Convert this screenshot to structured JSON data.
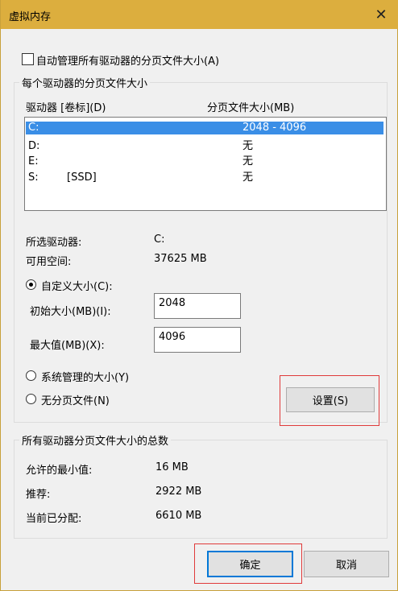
{
  "window": {
    "title": "虚拟内存",
    "close_glyph": "✕"
  },
  "auto_manage": {
    "label": "自动管理所有驱动器的分页文件大小(A)",
    "checked": false
  },
  "per_drive_group": {
    "legend": "每个驱动器的分页文件大小",
    "col_drive": "驱动器 [卷标](D)",
    "col_size": "分页文件大小(MB)",
    "rows": [
      {
        "drive": "C:",
        "label": "",
        "size": "2048 - 4096",
        "selected": true
      },
      {
        "drive": "D:",
        "label": "",
        "size": "无",
        "selected": false
      },
      {
        "drive": "E:",
        "label": "",
        "size": "无",
        "selected": false
      },
      {
        "drive": "S:",
        "label": "[SSD]",
        "size": "无",
        "selected": false
      }
    ],
    "selected_drive_label": "所选驱动器:",
    "selected_drive_value": "C:",
    "free_space_label": "可用空间:",
    "free_space_value": "37625 MB",
    "custom_size_label": "自定义大小(C):",
    "initial_size_label": "初始大小(MB)(I):",
    "initial_size_value": "2048",
    "max_size_label": "最大值(MB)(X):",
    "max_size_value": "4096",
    "system_managed_label": "系统管理的大小(Y)",
    "no_paging_label": "无分页文件(N)",
    "set_button": "设置(S)"
  },
  "totals_group": {
    "legend": "所有驱动器分页文件大小的总数",
    "min_label": "允许的最小值:",
    "min_value": "16 MB",
    "recommended_label": "推荐:",
    "recommended_value": "2922 MB",
    "current_label": "当前已分配:",
    "current_value": "6610 MB"
  },
  "footer": {
    "ok_button": "确定",
    "cancel_button": "取消"
  },
  "colors": {
    "titlebar": "#dcae3e",
    "selection": "#3a8ee6",
    "highlight": "#e03a3a",
    "default_button_border": "#0078d7"
  }
}
